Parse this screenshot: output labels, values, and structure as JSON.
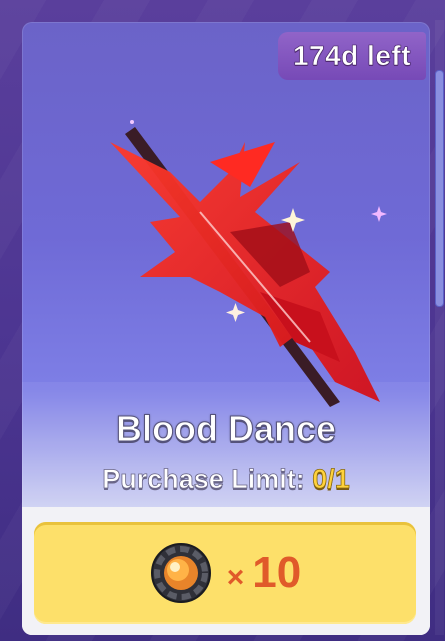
{
  "timer": {
    "text": "174d left"
  },
  "item": {
    "name": "Blood Dance",
    "icon": "blood-dance-weapon-icon",
    "accent_color": "#e0181e"
  },
  "purchase_limit": {
    "label": "Purchase Limit:",
    "count": "0/1"
  },
  "price": {
    "currency_icon": "orb-currency-icon",
    "multiplier": "×",
    "amount": "10",
    "button_color": "#fde06a"
  }
}
